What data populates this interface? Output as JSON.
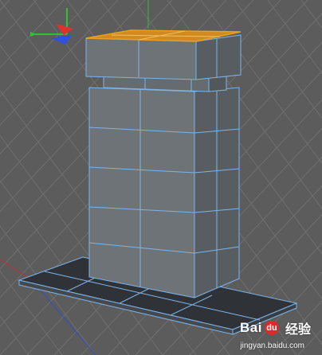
{
  "viewport": {
    "background": "#5c5c5c",
    "grid_color": "#6f6f6f",
    "wire_color": "#7db4e8",
    "face_front": "#6e7378",
    "face_side": "#565b60",
    "face_dark": "#2f3338",
    "selection_color": "#e8a020",
    "gizmo": {
      "x_axis_color": "#e03030",
      "y_axis_color": "#30c030",
      "z_axis_color": "#3050e0"
    },
    "icons": [
      "move-gizmo-icon",
      "x-axis-handle-icon",
      "y-axis-handle-icon",
      "z-axis-handle-icon"
    ]
  },
  "watermark": {
    "pre": "Bai",
    "paw": "du",
    "post": "",
    "cn": "经验",
    "url": "jingyan.baidu.com"
  }
}
